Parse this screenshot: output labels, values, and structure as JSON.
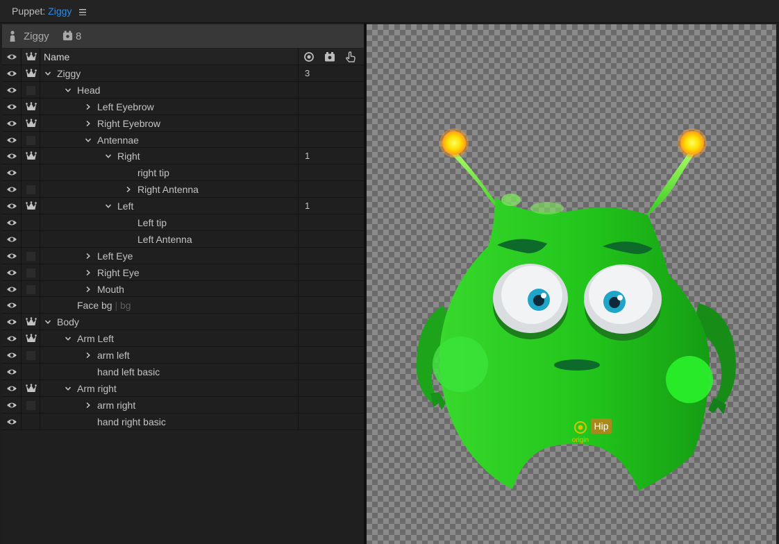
{
  "titlebar": {
    "label": "Puppet:",
    "puppet_name": "Ziggy",
    "menu_icon": "hamburger-menu-icon"
  },
  "panel_header": {
    "puppet_name": "Ziggy",
    "scene_count": "8"
  },
  "columns": {
    "name": "Name"
  },
  "rows": [
    {
      "label": "Ziggy",
      "chevron": "down",
      "crown": true,
      "count": "3"
    },
    {
      "label": "Head",
      "chevron": "down",
      "crown": false,
      "count": ""
    },
    {
      "label": "Left Eyebrow",
      "chevron": "right",
      "crown": true,
      "count": ""
    },
    {
      "label": "Right Eyebrow",
      "chevron": "right",
      "crown": true,
      "count": ""
    },
    {
      "label": "Antennae",
      "chevron": "down",
      "crown": false,
      "count": ""
    },
    {
      "label": "Right",
      "chevron": "down",
      "crown": true,
      "count": "1"
    },
    {
      "label": "right tip",
      "chevron": "none",
      "crown": null,
      "count": ""
    },
    {
      "label": "Right Antenna",
      "chevron": "right",
      "crown": false,
      "count": ""
    },
    {
      "label": "Left",
      "chevron": "down",
      "crown": true,
      "count": "1"
    },
    {
      "label": "Left tip",
      "chevron": "none",
      "crown": null,
      "count": ""
    },
    {
      "label": "Left Antenna",
      "chevron": "none",
      "crown": null,
      "count": ""
    },
    {
      "label": "Left Eye",
      "chevron": "right",
      "crown": false,
      "count": ""
    },
    {
      "label": "Right Eye",
      "chevron": "right",
      "crown": false,
      "count": ""
    },
    {
      "label": "Mouth",
      "chevron": "right",
      "crown": false,
      "count": ""
    },
    {
      "label": "Face bg",
      "suffix": "bg",
      "chevron": "none",
      "crown": null,
      "count": ""
    },
    {
      "label": "Body",
      "chevron": "down",
      "crown": true,
      "count": ""
    },
    {
      "label": "Arm Left",
      "chevron": "down",
      "crown": true,
      "count": ""
    },
    {
      "label": "arm left",
      "chevron": "right",
      "crown": false,
      "count": ""
    },
    {
      "label": "hand left basic",
      "chevron": "none",
      "crown": null,
      "count": ""
    },
    {
      "label": "Arm right",
      "chevron": "down",
      "crown": true,
      "count": ""
    },
    {
      "label": "arm right",
      "chevron": "right",
      "crown": false,
      "count": ""
    },
    {
      "label": "hand right basic",
      "chevron": "none",
      "crown": null,
      "count": ""
    }
  ],
  "stage": {
    "hip_label": "Hip",
    "origin_label": "origin"
  },
  "colors": {
    "accent": "#2d8ceb",
    "body_green": "#2ecc1f",
    "antenna_glow": "#ffe21a",
    "hip_badge": "#a88a1c"
  }
}
